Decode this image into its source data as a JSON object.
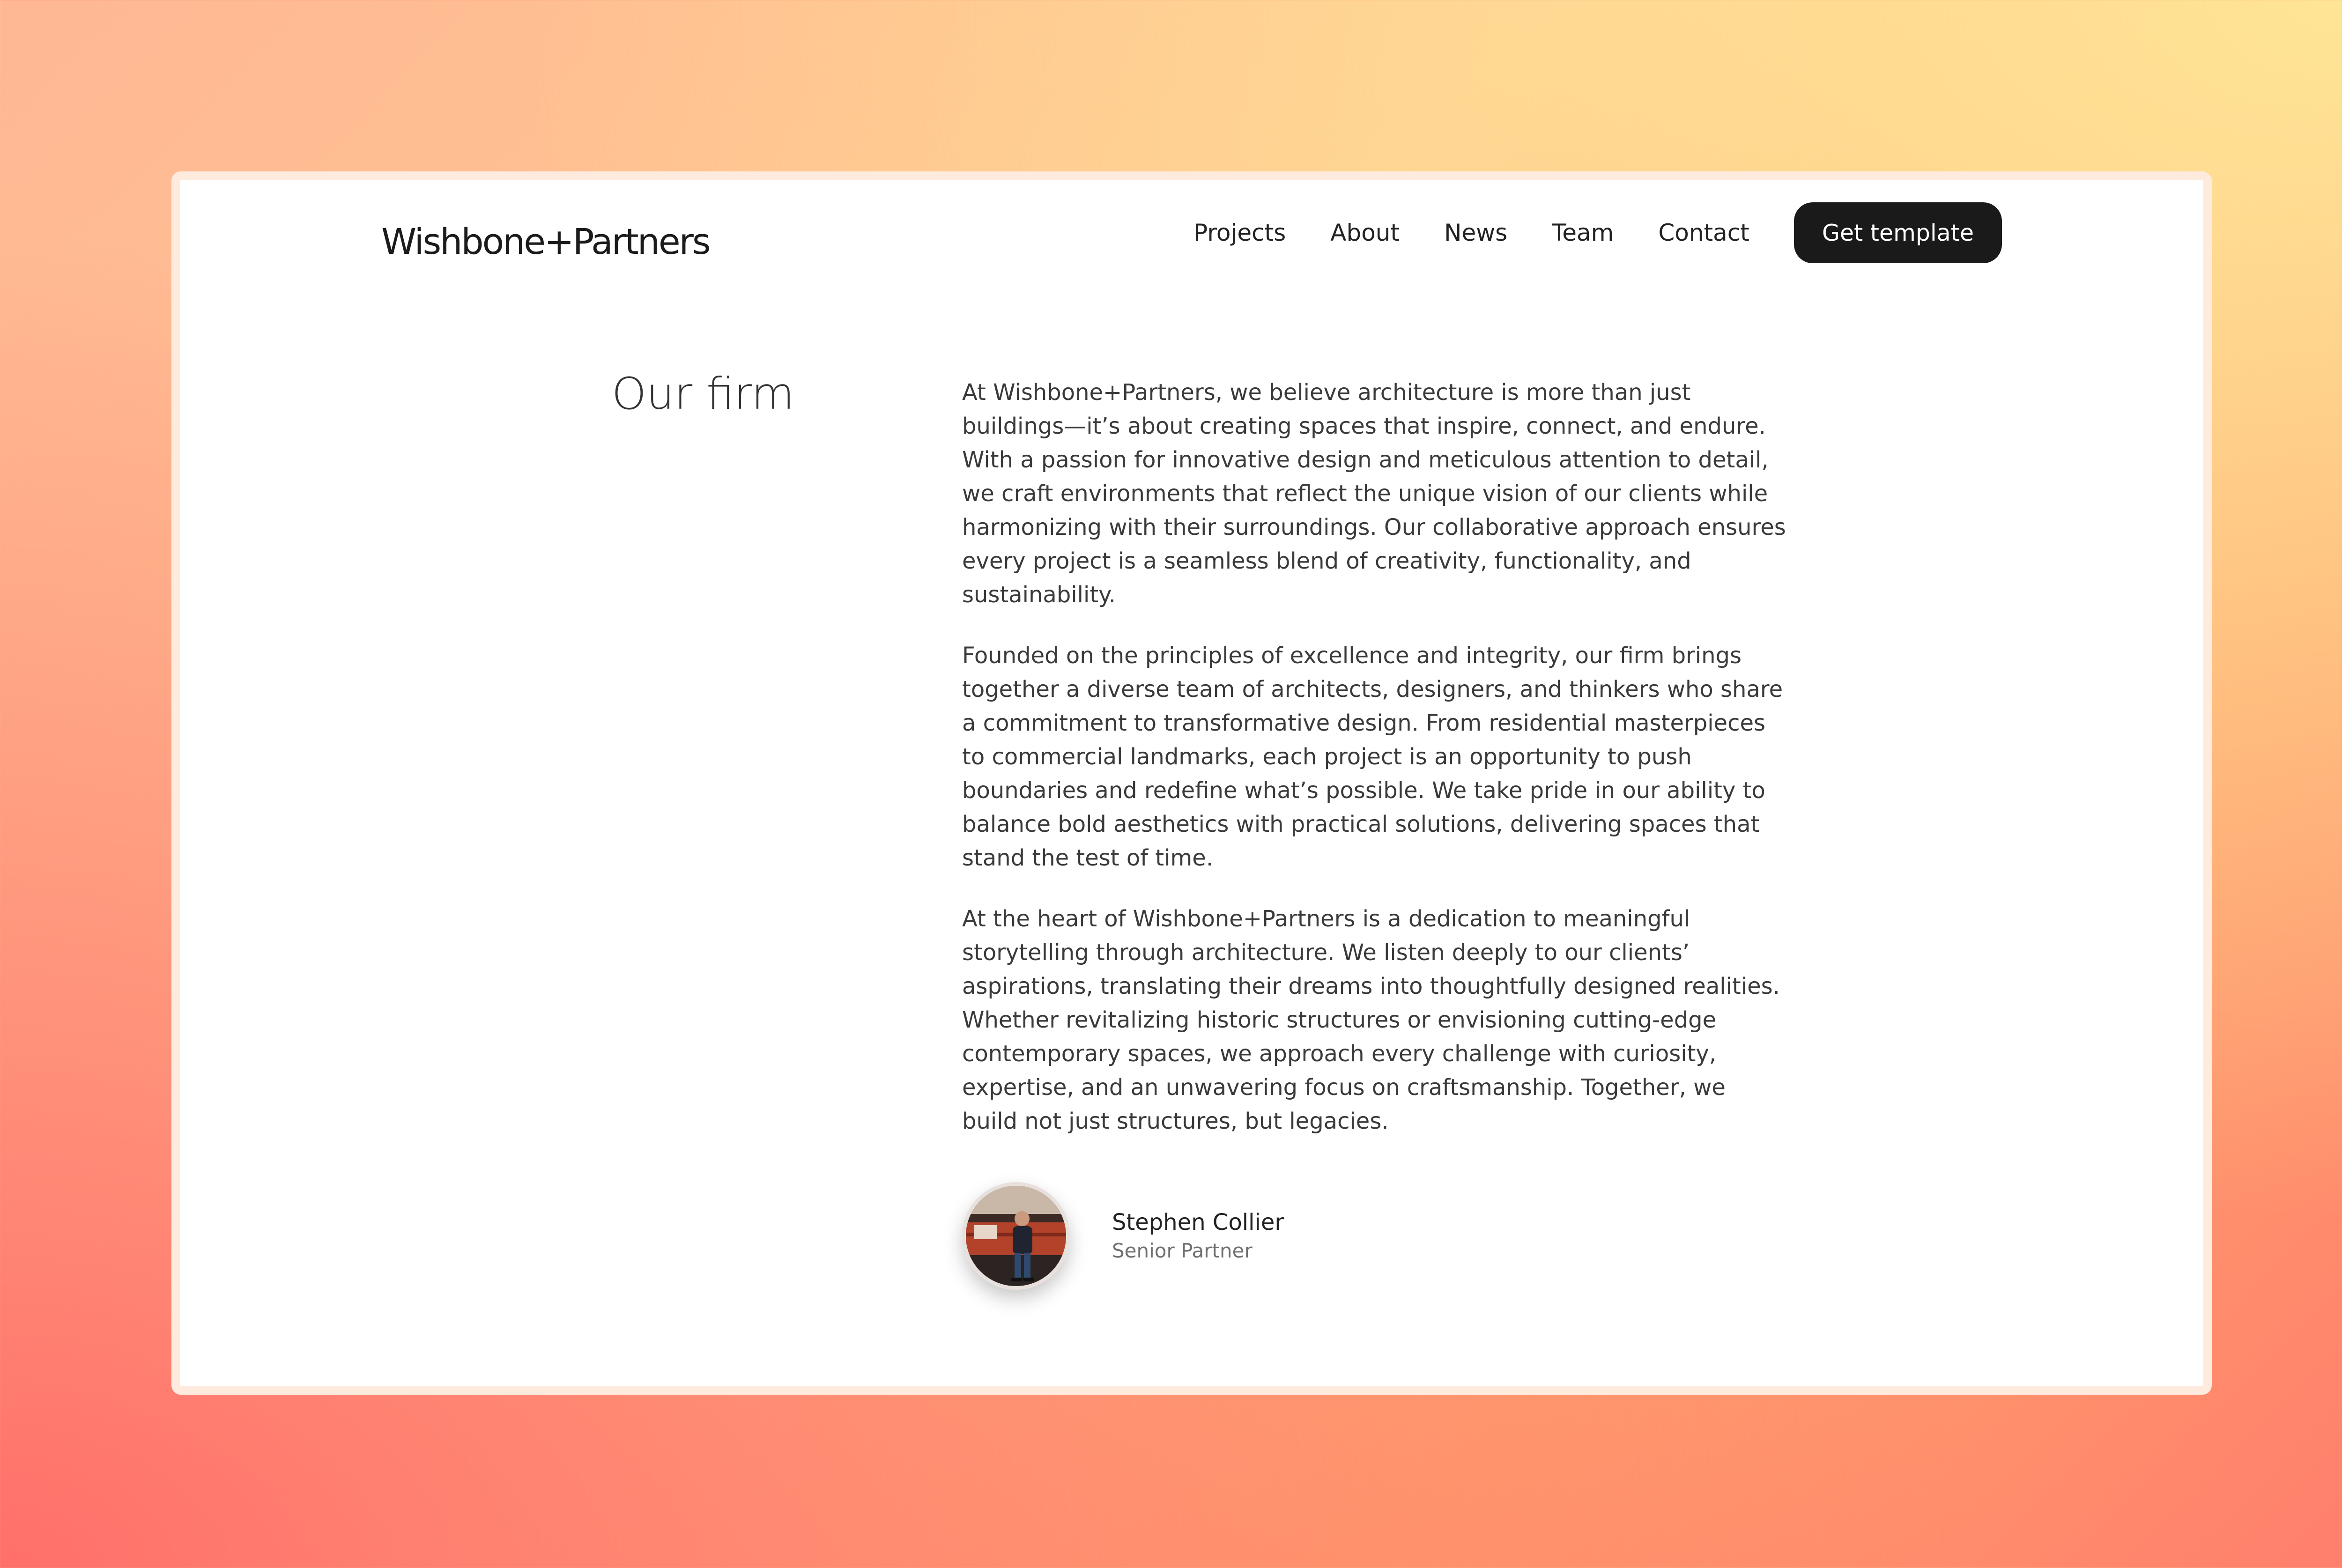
{
  "site": {
    "logo": "Wishbone+Partners"
  },
  "nav": {
    "items": [
      {
        "label": "Projects"
      },
      {
        "label": "About"
      },
      {
        "label": "News"
      },
      {
        "label": "Team"
      },
      {
        "label": "Contact"
      }
    ],
    "cta_label": "Get template"
  },
  "section": {
    "title": "Our firm",
    "paragraphs": [
      "At Wishbone+Partners, we believe architecture is more than just buildings—it’s about creating spaces that inspire, connect, and endure. With a passion for innovative design and meticulous attention to detail, we craft environments that reflect the unique vision of our clients while harmonizing with their surroundings. Our collaborative approach ensures every project is a seamless blend of creativity, functionality, and sustainability.",
      "Founded on the principles of excellence and integrity, our firm brings together a diverse team of architects, designers, and thinkers who share a commitment to transformative design. From residential masterpieces to commercial landmarks, each project is an opportunity to push boundaries and redefine what’s possible. We take pride in our ability to balance bold aesthetics with practical solutions, delivering spaces that stand the test of time.",
      "At the heart of Wishbone+Partners is a dedication to meaningful storytelling through architecture. We listen deeply to our clients’ aspirations, translating their dreams into thoughtfully designed realities. Whether revitalizing historic structures or envisioning cutting-edge contemporary spaces, we approach every challenge with curiosity, expertise, and an unwavering focus on craftsmanship. Together, we build not just structures, but legacies."
    ]
  },
  "author": {
    "name": "Stephen Collier",
    "role": "Senior Partner"
  },
  "colors": {
    "cta_background": "#1a1a1a",
    "cta_text": "#ffffff",
    "text_primary": "#222222",
    "text_secondary": "#6f6f6f",
    "page_background_warm": "#ffc98f",
    "page_background_red": "#ff6f6a"
  }
}
